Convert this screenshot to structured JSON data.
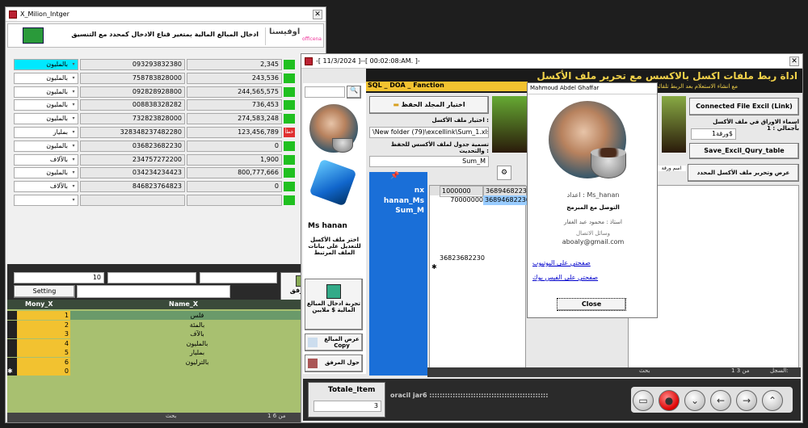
{
  "win1": {
    "title": "X_Milion_Intger",
    "header_text": "ادخال المبالغ المالية  بمتغير قناع الادخال كمحدد مع التنسيق",
    "logo_text": "اوفيسنا",
    "logo_sub": "officena",
    "rows": [
      {
        "unit": "بالمليون",
        "code": "093293832380",
        "value": "2,345",
        "flag": "green",
        "highlight": true
      },
      {
        "unit": "بالمليون",
        "code": "758783828000",
        "value": "243,536",
        "flag": "green"
      },
      {
        "unit": "بالمليون",
        "code": "092828928800",
        "value": "244,565,575",
        "flag": "green"
      },
      {
        "unit": "بالمليون",
        "code": "008838328282",
        "value": "736,453",
        "flag": "green"
      },
      {
        "unit": "بالمليون",
        "code": "732823828000",
        "value": "274,583,248",
        "flag": "green"
      },
      {
        "unit": "بمليار",
        "code": "328348237482280",
        "value": "123,456,789",
        "flag": "red",
        "flag_text": "خطأ"
      },
      {
        "unit": "بالمليون",
        "code": "036823682230",
        "value": "0",
        "flag": "green"
      },
      {
        "unit": "بالآلاف",
        "code": "234757272200",
        "value": "1,900",
        "flag": "green"
      },
      {
        "unit": "بالمليون",
        "code": "034234234423",
        "value": "800,777,666",
        "flag": "green"
      },
      {
        "unit": "بالآلاف",
        "code": "846823764823",
        "value": "0",
        "flag": "green"
      },
      {
        "unit": "",
        "code": "",
        "value": "",
        "flag": "green"
      }
    ],
    "count_value": "10",
    "setting_label": "Setting",
    "attach_label": "المرفق",
    "table": {
      "col1": "Mony_X",
      "col2": "Name_X",
      "rows": [
        {
          "n": "1",
          "name": "فلس"
        },
        {
          "n": "2",
          "name": "بالمئة"
        },
        {
          "n": "3",
          "name": "بالآف"
        },
        {
          "n": "4",
          "name": "بالمليون"
        },
        {
          "n": "5",
          "name": "بمليار"
        },
        {
          "n": "6",
          "name": "بالترليون"
        },
        {
          "n": "0",
          "name": ""
        }
      ]
    },
    "status_record": "1 من 6",
    "status_search": "بحث"
  },
  "win2": {
    "title": "-[ 11/3/2024 ]--[ 00:02:08:AM. ]-",
    "banner": "اداة ربط ملفات اكسل بالاكسس مع تحرير ملف الأكسل",
    "sub_banner": "مع انشاء الاستعلام بعد الربط تلقائي",
    "sql_bar": "SQL _ DOA _ Fanction",
    "btn_choose_folder": "اختيار المجلد الحفظ",
    "label_choose_file": "اختيار ملف الأكسل :",
    "file_path": "\\New folder (79)\\excellink\\Sum_1.xlsx",
    "label_table_name": "تسمية جدول لملف الأكسس للحفظ والتحديث :",
    "table_name": "Sum_M",
    "btn_connected": "Connected File Excil (Link)",
    "label_sheets": "اسماء الاوراق في ملف الأكسل بأجمالي : 1",
    "sheet_value": "ورقة1$",
    "btn_save": "Save_Excil_Qury_table",
    "btn_view": "عرض وتحرير ملف الأكسل المحدد",
    "sheet_label": "اسم ورقة",
    "user_name": "Ms hanan",
    "left_desc": "اختر ملف الأكسل للتعديل على بيانات الملف المرتبط",
    "btn_test": "تجربة ادخال المبالغ المالية $ ملايين",
    "btn_show": "عرض المبالغ Copy",
    "btn_about": "حول المرفق",
    "grid_title": "nx",
    "grid_rows_label": "hanan_Ms Sum_M",
    "grid": {
      "header": [
        "1000000",
        "3689468223"
      ],
      "row1": [
        "70000000",
        "36894682230"
      ],
      "row_last": "36823682230"
    },
    "total_label": "Totale_Item",
    "total_value": "3",
    "footer": "oracil jar6 ::::::::::::::::::::::::::::::::::::::::::::::",
    "status_search": "بحث",
    "status_record": "1 من 3",
    "status_label": "السجل:"
  },
  "popup": {
    "title": "Mahmoud Abdel Ghaffar",
    "prepared_by": "اعداد : Ms_hanan",
    "contact": "التوصل مع المبرمج",
    "teacher": "استاذ : محمود عبد الغفار",
    "contact_means": "وسائل الاتصال",
    "email": "aboaly@gmail.com",
    "link1": "صفحتي على اليوتيوب",
    "link2": "صفحتي على الفيس بوك",
    "close": "Close"
  },
  "colors": {
    "banner_bg": "#1a1a1a",
    "banner_text": "#f2d24a",
    "blue_panel": "#1a6fd8",
    "yellow": "#f2c230",
    "olive": "#a8c070",
    "cyan": "#00e8ff"
  }
}
